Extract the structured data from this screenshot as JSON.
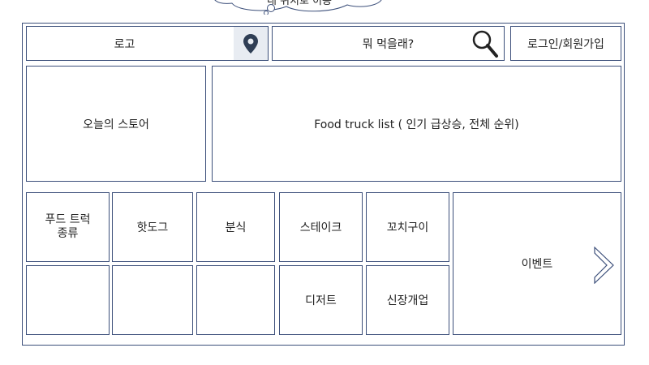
{
  "tooltip": {
    "text": "내 위치로 이동"
  },
  "header": {
    "logo_label": "로고",
    "search_label": "뭐 먹을래?",
    "login_label": "로그인/회원가입"
  },
  "banners": {
    "today_store": "오늘의 스토어",
    "food_truck_list": "Food truck list ( 인기 급상승, 전체 순위)"
  },
  "categories": {
    "title": "푸드 트럭\n종류",
    "items": [
      "핫도그",
      "분식",
      "스테이크",
      "꼬치구이",
      "디저트",
      "신장개업"
    ]
  },
  "event": {
    "label": "이벤트"
  },
  "icons": {
    "location": "map-pin-icon",
    "search": "magnifier-icon",
    "next": "chevron-right-icon"
  },
  "colors": {
    "border": "#3c4f7a",
    "pin": "#2f3e55",
    "pin_bg": "#e8ecf2"
  }
}
